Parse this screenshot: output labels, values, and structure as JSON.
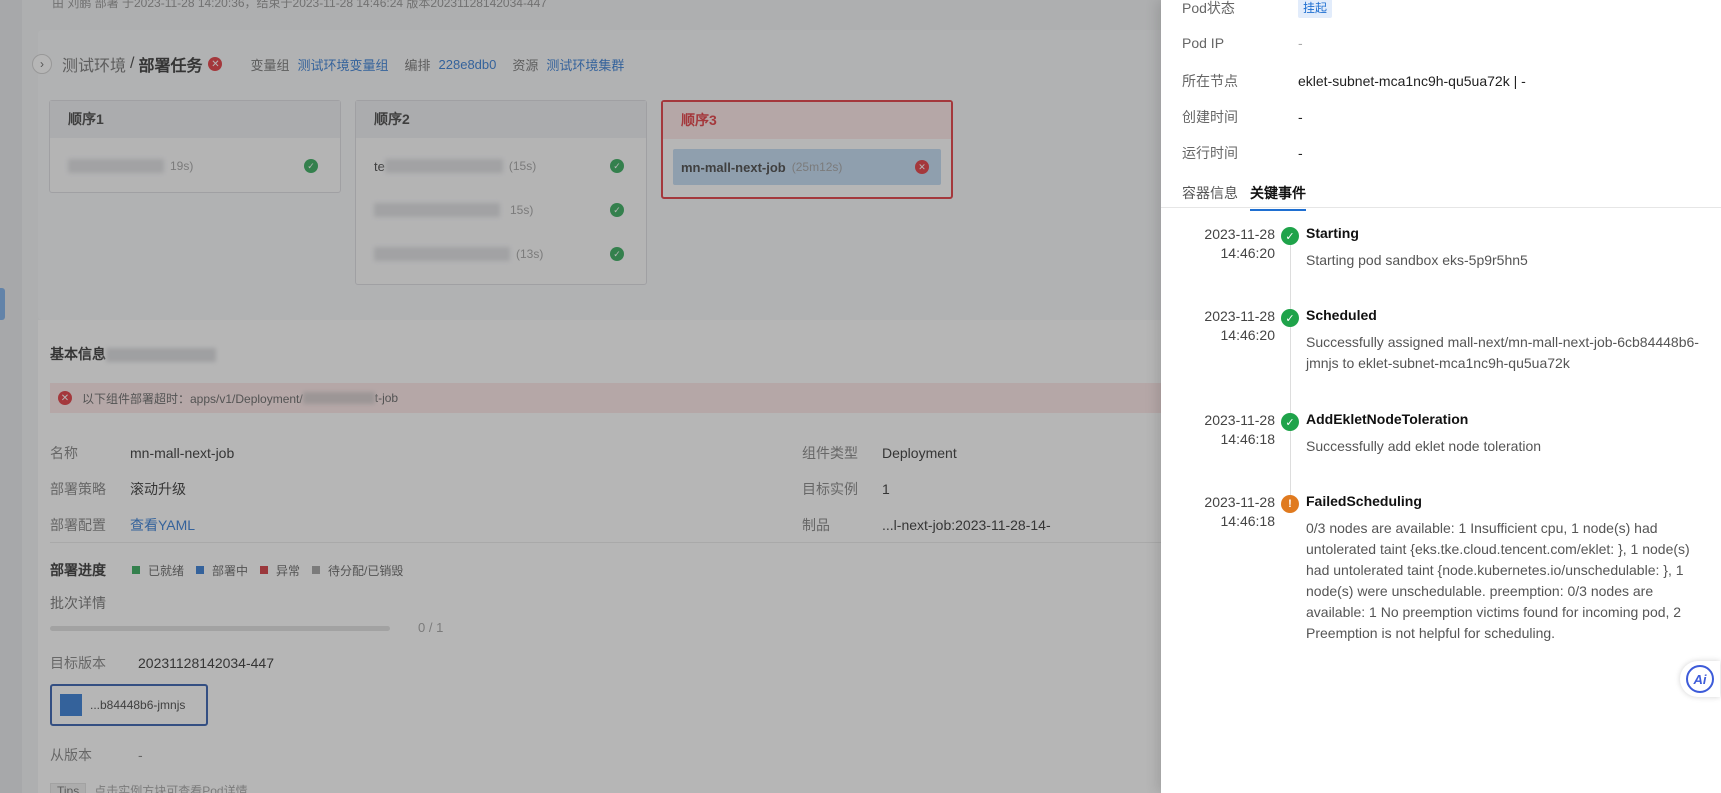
{
  "header": {
    "top_info": "由 刘鹏 部署 于2023-11-28 14:20:36，结束于2023-11-28 14:46:24 版本20231128142034-447"
  },
  "task": {
    "env": "测试环境",
    "separator": "/",
    "title": "部署任务",
    "meta": [
      {
        "key": "变量组",
        "value": "测试环境变量组"
      },
      {
        "key": "编排",
        "value": "228e8db0"
      },
      {
        "key": "资源",
        "value": "测试环境集群"
      }
    ]
  },
  "stages": [
    {
      "name": "顺序1",
      "jobs": [
        {
          "name": "",
          "duration": "19s)",
          "status": "success"
        }
      ]
    },
    {
      "name": "顺序2",
      "jobs": [
        {
          "name": "te",
          "duration": "(15s)",
          "status": "success"
        },
        {
          "name": "",
          "duration": "15s)",
          "status": "success"
        },
        {
          "name": "",
          "duration": "(13s)",
          "status": "success"
        }
      ]
    },
    {
      "name": "顺序3",
      "jobs": [
        {
          "name": "mn-mall-next-job",
          "duration": "(25m12s)",
          "status": "error"
        }
      ]
    }
  ],
  "basic_info": {
    "title": "基本信息",
    "alert_prefix": "以下组件部署超时：apps/v1/Deployment/",
    "alert_suffix": "t-job",
    "fields": {
      "name_key": "名称",
      "name_value": "mn-mall-next-job",
      "strategy_key": "部署策略",
      "strategy_value": "滚动升级",
      "config_key": "部署配置",
      "config_value": "查看YAML",
      "type_key": "组件类型",
      "type_value": "Deployment",
      "instances_key": "目标实例",
      "instances_value": "1",
      "artifact_key": "制品",
      "artifact_value": "...l-next-job:2023-11-28-14-"
    }
  },
  "progress": {
    "title": "部署进度",
    "legend": [
      {
        "label": "已就绪",
        "color": "#1fa34a"
      },
      {
        "label": "部署中",
        "color": "#1f6fd1"
      },
      {
        "label": "异常",
        "color": "#d0262d"
      },
      {
        "label": "待分配/已销毁",
        "color": "#999999"
      }
    ],
    "batch_label": "批次详情",
    "fraction": 0,
    "count_text": "0 / 1",
    "target_version_key": "目标版本",
    "target_version_value": "20231128142034-447",
    "pod_chip": "...b84448b6-jmnjs",
    "from_version_key": "从版本",
    "from_version_value": "-",
    "tips_tag": "Tips",
    "tips_text": "点击实例方块可查看Pod详情"
  },
  "drawer": {
    "rows": [
      {
        "key": "Pod状态",
        "value": "挂起",
        "badge": true
      },
      {
        "key": "Pod IP",
        "value": "-"
      },
      {
        "key": "所在节点",
        "value": "eklet-subnet-mca1nc9h-qu5ua72k | -"
      },
      {
        "key": "创建时间",
        "value": "-"
      },
      {
        "key": "运行时间",
        "value": "-"
      }
    ],
    "tabs": [
      "容器信息",
      "关键事件"
    ],
    "active_tab": "关键事件",
    "events": [
      {
        "date": "2023-11-28",
        "time": "14:46:20",
        "status": "success",
        "title": "Starting",
        "desc": "Starting pod sandbox eks-5p9r5hn5"
      },
      {
        "date": "2023-11-28",
        "time": "14:46:20",
        "status": "success",
        "title": "Scheduled",
        "desc": "Successfully assigned mall-next/mn-mall-next-job-6cb84448b6-jmnjs to eklet-subnet-mca1nc9h-qu5ua72k"
      },
      {
        "date": "2023-11-28",
        "time": "14:46:18",
        "status": "success",
        "title": "AddEkletNodeToleration",
        "desc": "Successfully add eklet node toleration"
      },
      {
        "date": "2023-11-28",
        "time": "14:46:18",
        "status": "warning",
        "title": "FailedScheduling",
        "desc": "0/3 nodes are available: 1 Insufficient cpu, 1 node(s) had untolerated taint {eks.tke.cloud.tencent.com/eklet: }, 1 node(s) had untolerated taint {node.kubernetes.io/unschedulable: }, 1 node(s) were unschedulable. preemption: 0/3 nodes are available: 1 No preemption victims found for incoming pod, 2 Preemption is not helpful for scheduling."
      }
    ],
    "ai_label": "Ai"
  }
}
